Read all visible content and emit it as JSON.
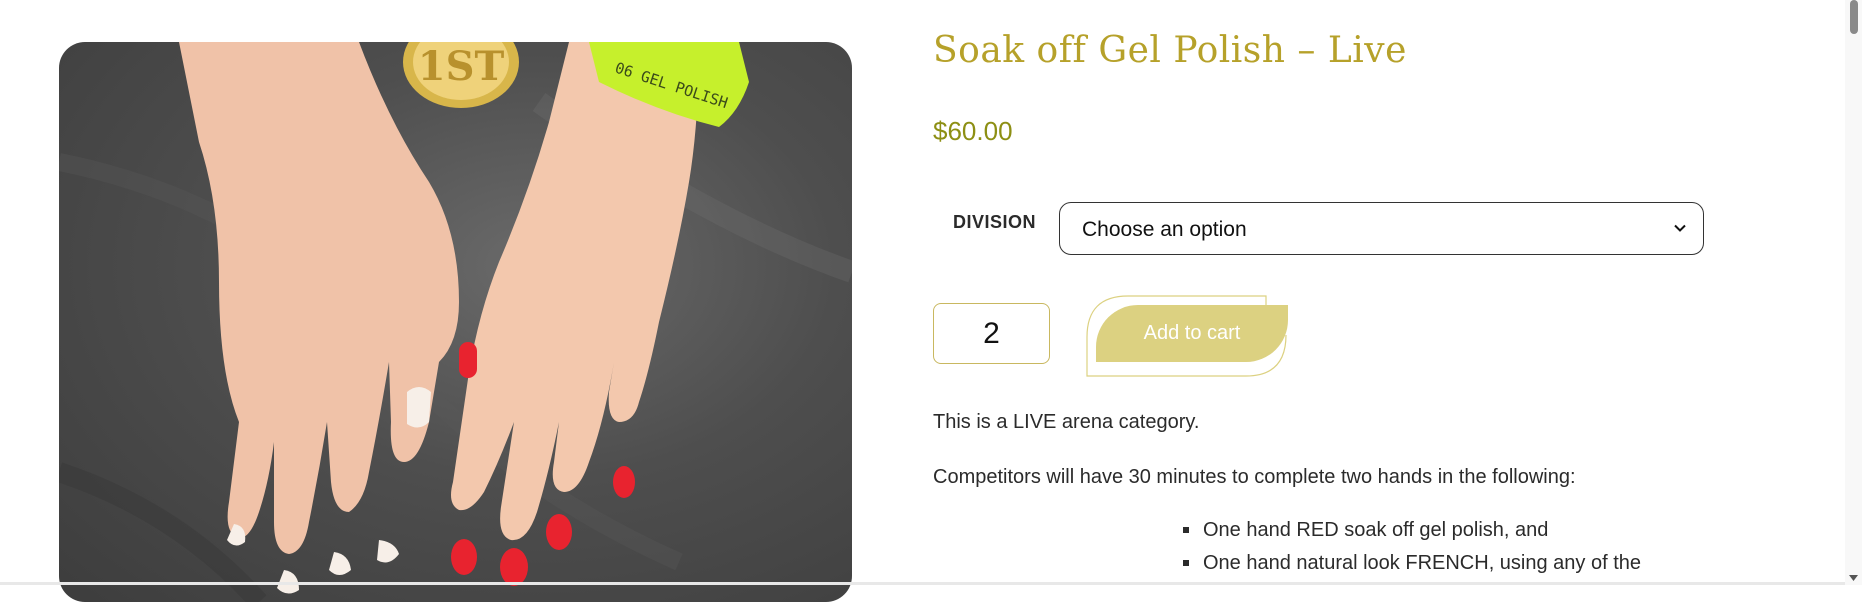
{
  "product": {
    "title": "Soak off Gel Polish – Live",
    "price": "$60.00",
    "image_alt": "Competition nails: one hand white french tips, one hand red gel polish",
    "image_text": {
      "medal": "1ST",
      "wristband": "06 GEL POLISH"
    }
  },
  "variation": {
    "label": "DIVISION",
    "selected": "Choose an option"
  },
  "cart": {
    "quantity": "2",
    "button_label": "Add to cart"
  },
  "description": {
    "paragraphs": [
      "This is a LIVE arena category.",
      "Competitors will have 30 minutes to complete two hands in the following:"
    ],
    "bullets": [
      "One hand RED soak off gel polish, and",
      "One hand natural look FRENCH, using any of the"
    ]
  },
  "colors": {
    "title": "#b6a12a",
    "price": "#8d8f14",
    "button": "#dcd181",
    "red_polish": "#e8232f",
    "wristband": "#c6f02c"
  },
  "icons": {
    "select_chevron": "chevron-down-icon",
    "scroll_up": "triangle-up-icon",
    "scroll_down": "triangle-down-icon"
  }
}
